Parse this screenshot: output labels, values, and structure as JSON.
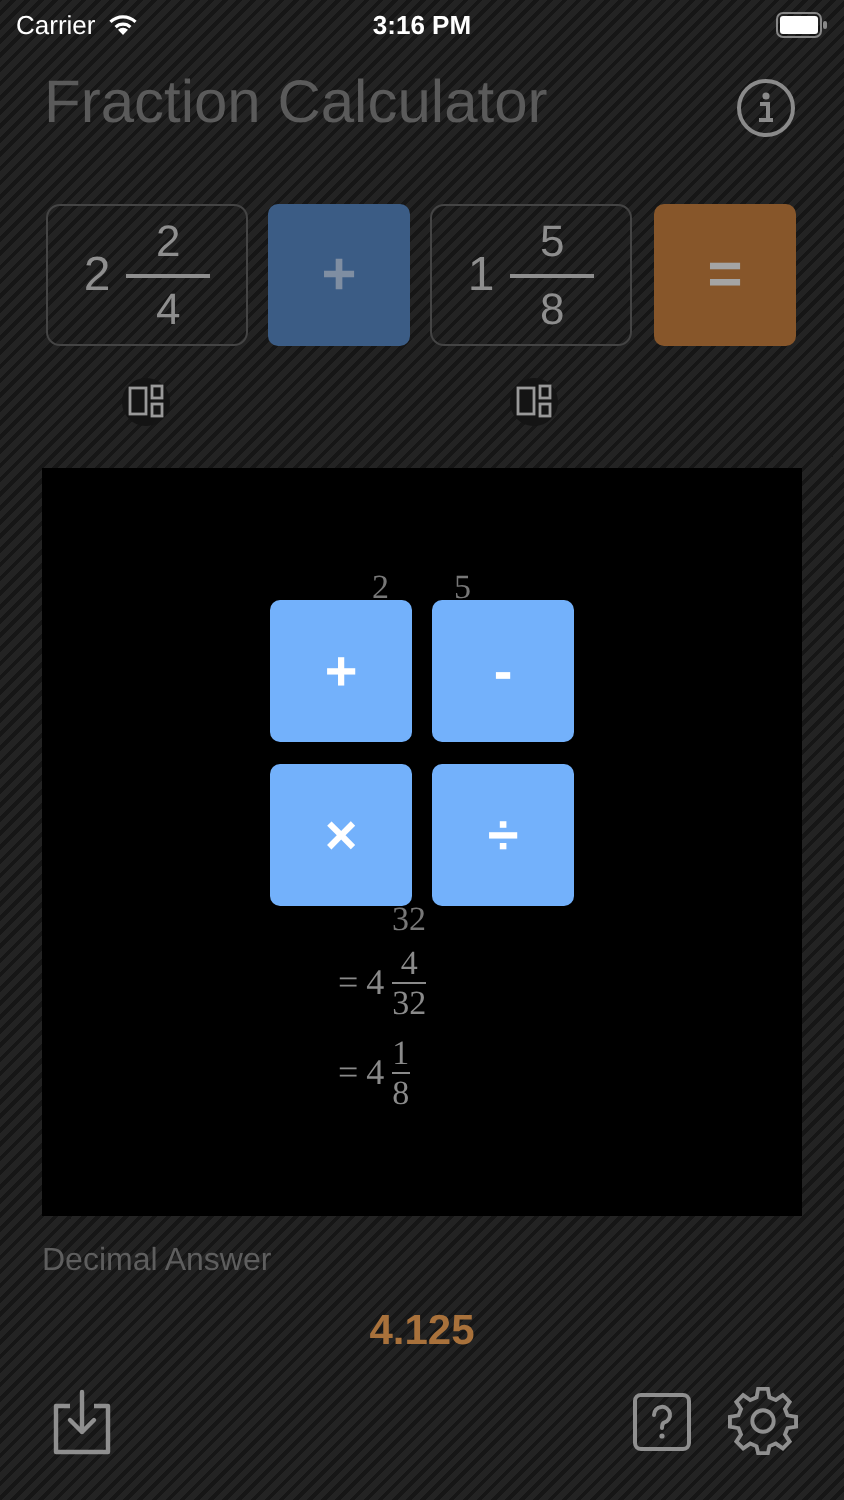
{
  "status_bar": {
    "carrier": "Carrier",
    "time": "3:16 PM"
  },
  "title": "Fraction Calculator",
  "operands": [
    {
      "whole": "2",
      "numerator": "2",
      "denominator": "4"
    },
    {
      "whole": "1",
      "numerator": "5",
      "denominator": "8"
    }
  ],
  "operator_button": "+",
  "equals_button": "=",
  "work": {
    "fragments": [
      "2",
      "5",
      "32"
    ],
    "steps": [
      {
        "prefix": "=",
        "whole": "4",
        "numerator": "4",
        "denominator": "32"
      },
      {
        "prefix": "=",
        "whole": "4",
        "numerator": "1",
        "denominator": "8"
      }
    ]
  },
  "operator_menu": [
    "+",
    "-",
    "×",
    "÷"
  ],
  "decimal_label": "Decimal Answer",
  "decimal_value": "4.125"
}
